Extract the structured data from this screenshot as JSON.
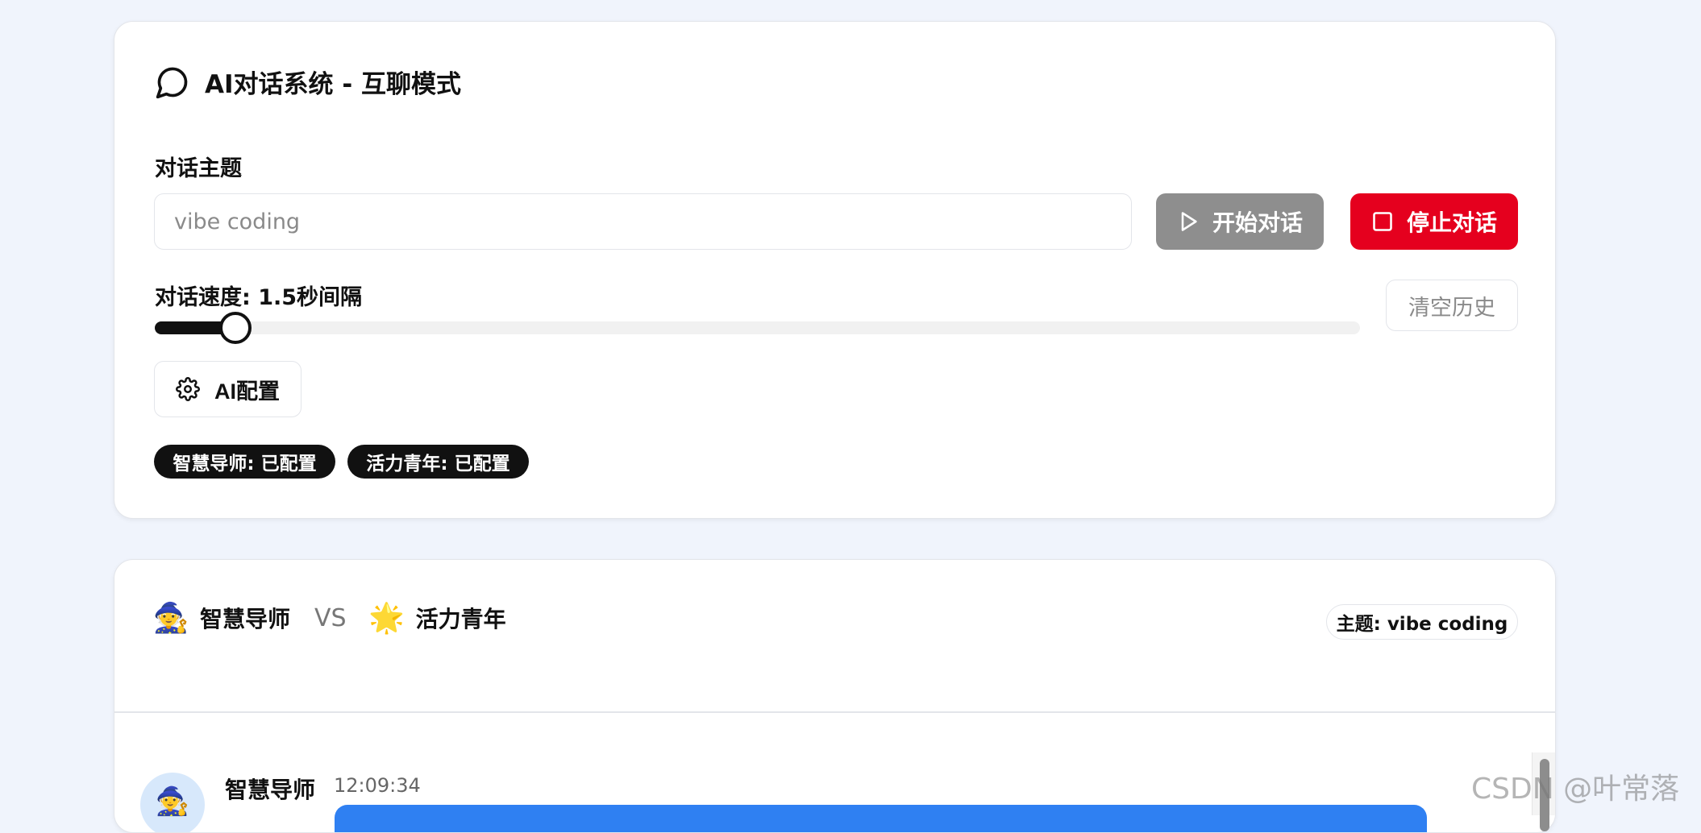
{
  "header": {
    "title": "AI对话系统 - 互聊模式",
    "icon": "chat-bubble-icon"
  },
  "controls": {
    "topic_label": "对话主题",
    "topic_placeholder": "vibe coding",
    "start_label": "开始对话",
    "stop_label": "停止对话",
    "speed_label": "对话速度: 1.5秒间隔",
    "speed_value_fraction": 0.067,
    "clear_label": "清空历史",
    "config_label": "AI配置"
  },
  "status_badges": [
    {
      "label": "智慧导师: 已配置"
    },
    {
      "label": "活力青年: 已配置"
    }
  ],
  "conversation": {
    "agent1": {
      "emoji": "🧙",
      "name": "智慧导师"
    },
    "vs": "VS",
    "agent2": {
      "emoji": "🌟",
      "name": "活力青年"
    },
    "topic_badge": "主题: vibe coding"
  },
  "messages": [
    {
      "avatar": "🧙",
      "name": "智慧导师",
      "time": "12:09:34"
    }
  ],
  "watermark": "CSDN @叶常落",
  "colors": {
    "accent_blue": "#2f80f2",
    "stop_red": "#e5001e",
    "start_gray": "#8e8e8e",
    "badge_dark": "#111111",
    "background": "#f0f4fc"
  }
}
